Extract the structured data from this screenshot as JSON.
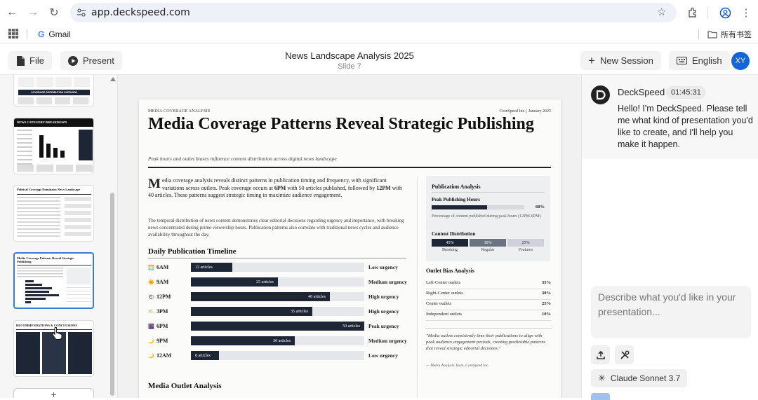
{
  "browser": {
    "url": "app.deckspeed.com",
    "bookmarks": {
      "gmail": "Gmail",
      "folder": "所有书签"
    }
  },
  "header": {
    "file_label": "File",
    "present_label": "Present",
    "title": "News Landscape Analysis 2025",
    "slide_label": "Slide 7",
    "new_session_label": "New Session",
    "language_label": "English",
    "avatar_initials": "XY"
  },
  "thumbnails": [
    {
      "caption": "COVERAGE DISTRIBUTION OVERVIEW"
    },
    {
      "caption": "NEWS CATEGORY BREAKDOWN"
    },
    {
      "caption": "Political Coverage Dominates News Landscape"
    },
    {
      "caption": "Media Coverage Patterns Reveal Strategic Publishing",
      "active": true
    },
    {
      "caption": "RECOMMENDATIONS & CONCLUSIONS"
    }
  ],
  "slide": {
    "kicker": "MEDIA COVERAGE ANALYSIS",
    "corp": "CoreSpeed Inc. | January 2025",
    "title": "Media Coverage Patterns Reveal Strategic Publishing",
    "subtitle": "Peak hours and outlet biases influence content distribution across digital news landscape",
    "lead_dropcap": "M",
    "lead_text": "edia coverage analysis reveals distinct patterns in publication timing and frequency, with significant variations across outlets. Peak coverage occurs at 6PM with 50 articles published, followed by 12PM with 40 articles. These patterns suggest strategic timing to maximize audience engagement.",
    "para2": "The temporal distribution of news content demonstrates clear editorial decisions regarding urgency and importance, with breaking news concentrated during prime viewership hours. Publication patterns also correlate with traditional news cycles and audience availability throughout the day.",
    "timeline_heading": "Daily Publication Timeline",
    "outlet_heading": "Media Outlet Analysis",
    "timeline": [
      {
        "icon": "sunrise-icon",
        "glyph": "🌅",
        "time": "6AM",
        "articles": 12,
        "label": "12 articles",
        "level": "Low urgency"
      },
      {
        "icon": "sun-icon",
        "glyph": "🌞",
        "time": "9AM",
        "articles": 25,
        "label": "25 articles",
        "level": "Medium urgency"
      },
      {
        "icon": "noon-icon",
        "glyph": "🌤",
        "time": "12PM",
        "articles": 40,
        "label": "40 articles",
        "level": "High urgency"
      },
      {
        "icon": "afternoon-icon",
        "glyph": "⛅",
        "time": "3PM",
        "articles": 35,
        "label": "35 articles",
        "level": "High urgency"
      },
      {
        "icon": "evening-icon",
        "glyph": "🌆",
        "time": "6PM",
        "articles": 50,
        "label": "50 articles",
        "level": "Peak urgency"
      },
      {
        "icon": "moon-icon",
        "glyph": "🌙",
        "time": "9PM",
        "articles": 30,
        "label": "30 articles",
        "level": "Medium urgency"
      },
      {
        "icon": "crescent-icon",
        "glyph": "🌙",
        "time": "12AM",
        "articles": 8,
        "label": "8 articles",
        "level": "Low urgency"
      }
    ],
    "timeline_max": 50,
    "analysis": {
      "heading": "Publication Analysis",
      "peak_heading": "Peak Publishing Hours",
      "peak_pct": "60%",
      "peak_value": 0.6,
      "peak_note": "Percentage of content published during peak hours (12PM-6PM)",
      "dist_heading": "Content Distribution",
      "dist": [
        {
          "pct": "45%",
          "label": "Breaking",
          "color": "#1e2535",
          "text_color": "#ffffff"
        },
        {
          "pct": "30%",
          "label": "Regular",
          "color": "#6c7280",
          "text_color": "#ffffff"
        },
        {
          "pct": "25%",
          "label": "Features",
          "color": "#cfd2d8",
          "text_color": "#1e2535"
        }
      ]
    },
    "bias": {
      "heading": "Outlet Bias Analysis",
      "rows": [
        {
          "k": "Left-Center outlets",
          "v": "35%"
        },
        {
          "k": "Right-Center outlets",
          "v": "30%"
        },
        {
          "k": "Center outlets",
          "v": "25%"
        },
        {
          "k": "Independent outlets",
          "v": "10%"
        }
      ]
    },
    "quote": "\"Media outlets consistently time their publications to align with peak audience engagement periods, creating predictable patterns that reveal strategic editorial decisions.\"",
    "quote_att": "— Media Analysis Team, CoreSpeed Inc."
  },
  "chat": {
    "bot_name": "DeckSpeed",
    "bot_time": "01:45:31",
    "bot_message": "Hello! I'm DeckSpeed. Please tell me what kind of presentation you'd like to create, and I'll help you make it happen.",
    "input_placeholder": "Describe what you'd like in your presentation...",
    "model_label": "Claude Sonnet 3.7"
  }
}
